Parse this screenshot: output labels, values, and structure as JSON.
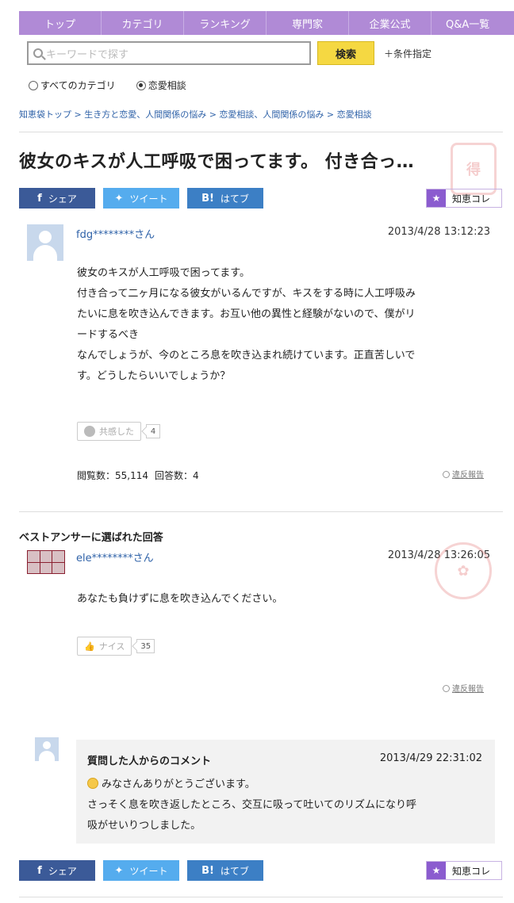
{
  "nav": {
    "items": [
      "トップ",
      "カテゴリ",
      "ランキング",
      "専門家",
      "企業公式",
      "Q&A一覧"
    ]
  },
  "search": {
    "placeholder": "キーワードで探す",
    "button_label": "検索",
    "condition_label": "＋条件指定",
    "scope_options": [
      "すべてのカテゴリ",
      "恋愛相談"
    ],
    "selected_scope": "恋愛相談"
  },
  "breadcrumb": "知恵袋トップ > 生き方と恋愛、人間関係の悩み > 恋愛相談、人間関係の悩み > 恋愛相談",
  "question": {
    "title": "彼女のキスが人工呼吸で困ってます。 付き合っ…",
    "user": "fdg********さん",
    "date": "2013/4/28  13:12:23",
    "body": [
      "彼女のキスが人工呼吸で困ってます。",
      "付き合って二ヶ月になる彼女がいるんですが、キスをする時に人工呼吸み",
      "たいに息を吹き込んできます。お互い他の異性と経験がないので、僕がリ",
      "ードするべき",
      "なんでしょうが、今のところ息を吹き込まれ続けています。正直苦しいで",
      "す。どうしたらいいでしょうか？"
    ],
    "empathy_label": "共感した",
    "empathy_count": "4",
    "views_label": "閲覧数：55,114",
    "answers_label": "回答数：4",
    "report_label": "違反報告"
  },
  "share": {
    "facebook": "シェア",
    "twitter": "ツイート",
    "hatena": "はてブ",
    "hatena_icon": "B!",
    "chiekore": "知恵コレ"
  },
  "best_answer": {
    "heading": "ベストアンサーに選ばれた回答",
    "user": "ele********さん",
    "date": "2013/4/28  13:26:05",
    "body": "あなたも負けずに息を吹き込んでください。",
    "nice_label": "ナイス",
    "nice_count": "35",
    "report_label": "違反報告"
  },
  "comment": {
    "title": "質問した人からのコメント",
    "date": "2013/4/29 22:31:02",
    "lines": [
      "みなさんありがとうございます。",
      "さっそく息を吹き返したところ、交互に吸って吐いてのリズムになり呼",
      "吸がせいりつしました。"
    ]
  },
  "colors": {
    "nav_bg": "#b08ad6",
    "search_button": "#f5d842",
    "link": "#2f62a8",
    "facebook": "#3b5a98",
    "twitter": "#55acee",
    "hatena": "#3c7fc5",
    "chiekore_star": "#8b5ccf"
  }
}
